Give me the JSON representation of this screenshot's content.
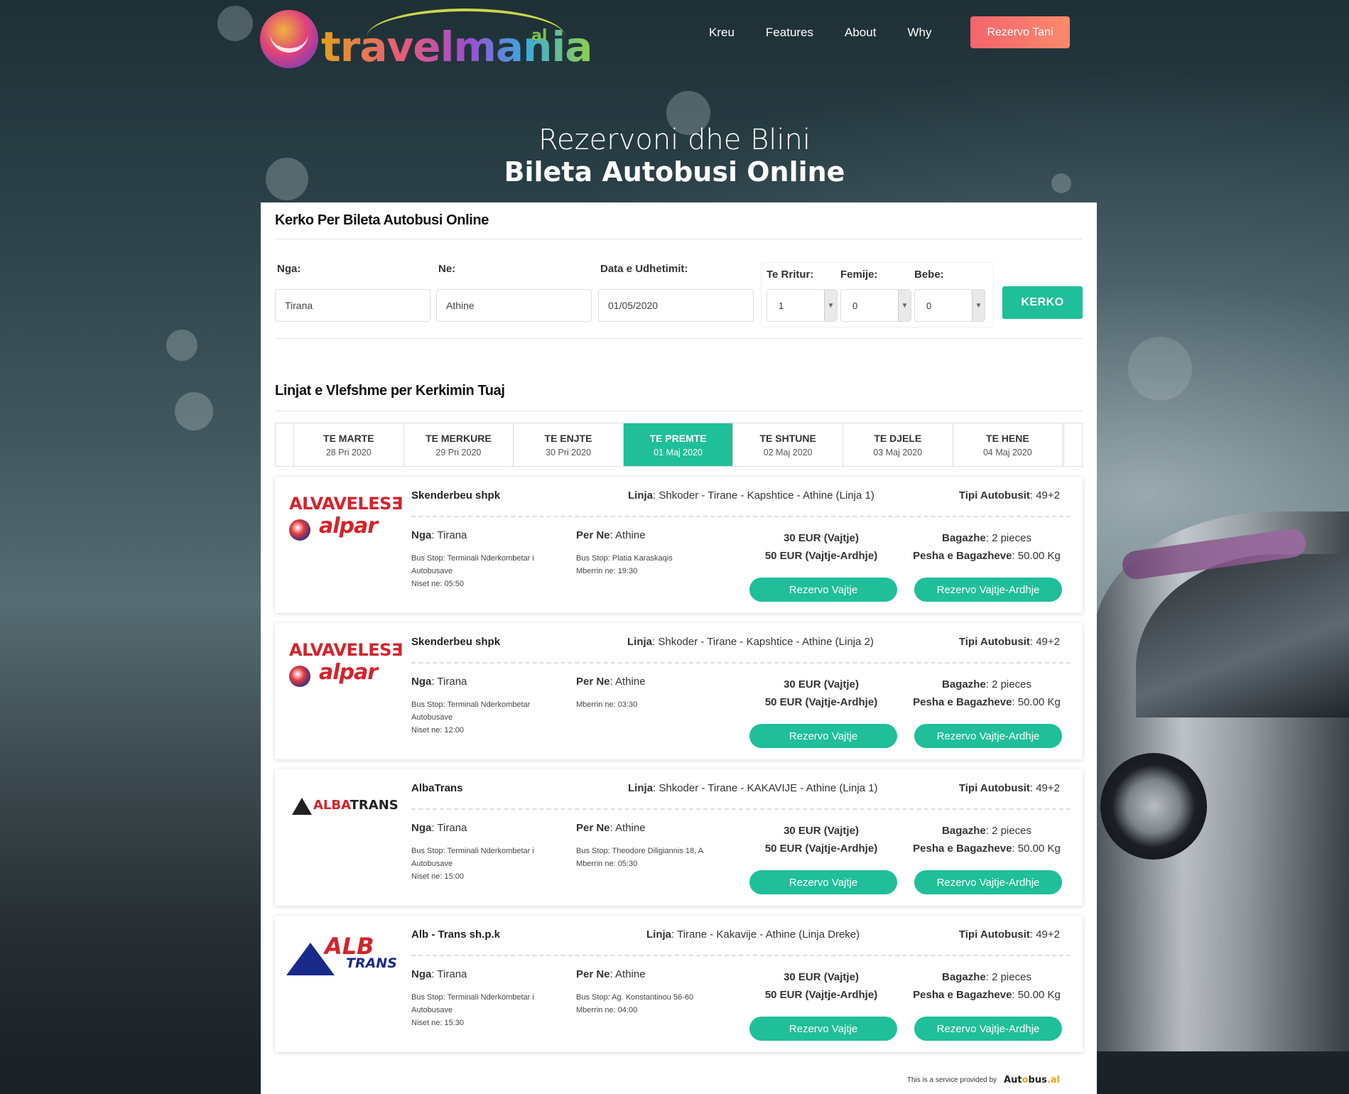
{
  "brand": {
    "name": "travelmania",
    "suffix": "al"
  },
  "nav": {
    "items": [
      "Kreu",
      "Features",
      "About",
      "Why"
    ],
    "cta": "Rezervo Tani"
  },
  "hero": {
    "line1": "Rezervoni dhe Blini",
    "line2": "Bileta Autobusi Online"
  },
  "search": {
    "title": "Kerko Per Bileta Autobusi Online",
    "from_label": "Nga:",
    "from_value": "Tirana",
    "to_label": "Ne:",
    "to_value": "Athine",
    "date_label": "Data e Udhetimit:",
    "date_value": "01/05/2020",
    "adults_label": "Te Rritur:",
    "adults_value": "1",
    "children_label": "Femije:",
    "children_value": "0",
    "infants_label": "Bebe:",
    "infants_value": "0",
    "submit": "KERKO"
  },
  "results": {
    "title": "Linjat e Vlefshme per Kerkimin Tuaj",
    "days": [
      {
        "name": "TE MARTE",
        "date": "28 Pri 2020"
      },
      {
        "name": "TE MERKURE",
        "date": "29 Pri 2020"
      },
      {
        "name": "TE ENJTE",
        "date": "30 Pri 2020"
      },
      {
        "name": "TE PREMTE",
        "date": "01 Maj 2020"
      },
      {
        "name": "TE SHTUNE",
        "date": "02 Maj 2020"
      },
      {
        "name": "TE DJELE",
        "date": "03 Maj 2020"
      },
      {
        "name": "TE HENE",
        "date": "04 Maj 2020"
      }
    ],
    "active_day": 3,
    "labels": {
      "route": "Linja",
      "bus_type": "Tipi Autobusit",
      "from": "Nga",
      "to": "Per Ne",
      "baggage": "Bagazhe",
      "baggage_weight": "Pesha e Bagazheve",
      "book_one_way": "Rezervo Vajtje",
      "book_return": "Rezervo Vajtje-Ardhje"
    },
    "cards": [
      {
        "logo_lines": [
          "ALVAVELESƎ",
          "alpar"
        ],
        "operator": "Skenderbeu shpk",
        "route": "Shkoder - Tirane - Kapshtice - Athine (Linja 1)",
        "bus_type": "49+2",
        "from": "Tirana",
        "to": "Athine",
        "from_stop": "Bus Stop: Terminali Nderkombetar i",
        "from_stop2": "Autobusave",
        "departure": "Niset ne: 05:50",
        "to_stop": "Bus Stop: Platia Karaskaqis",
        "arrival": "Mberrin ne: 19:30",
        "price_one": "30 EUR (Vajtje)",
        "price_return": "50 EUR (Vajtje-Ardhje)",
        "baggage": "2 pieces",
        "baggage_weight": "50.00 Kg"
      },
      {
        "logo_lines": [
          "ALVAVELESƎ",
          "alpar"
        ],
        "operator": "Skenderbeu shpk",
        "route": "Shkoder - Tirane - Kapshtice - Athine (Linja 2)",
        "bus_type": "49+2",
        "from": "Tirana",
        "to": "Athine",
        "from_stop": "Bus Stop: Terminali Nderkombetar",
        "from_stop2": "Autobusave",
        "departure": "Niset ne: 12:00",
        "to_stop": "",
        "arrival": "Mberrin ne: 03:30",
        "price_one": "30 EUR (Vajtje)",
        "price_return": "50 EUR (Vajtje-Ardhje)",
        "baggage": "2 pieces",
        "baggage_weight": "50.00 Kg"
      },
      {
        "logo_lines": [
          "ALBA",
          "TRANS"
        ],
        "operator": "AlbaTrans",
        "route": "Shkoder - Tirane - KAKAVIJE - Athine (Linja 1)",
        "bus_type": "49+2",
        "from": "Tirana",
        "to": "Athine",
        "from_stop": "Bus Stop: Terminali Nderkombetar i",
        "from_stop2": "Autobusave",
        "departure": "Niset ne: 15:00",
        "to_stop": "Bus Stop: Theodore Diligiannis 18, A",
        "arrival": "Mberrin ne: 05:30",
        "price_one": "30 EUR (Vajtje)",
        "price_return": "50 EUR (Vajtje-Ardhje)",
        "baggage": "2 pieces",
        "baggage_weight": "50.00 Kg"
      },
      {
        "logo_lines": [
          "ALB",
          "TRANS"
        ],
        "operator": "Alb - Trans sh.p.k",
        "route": "Tirane - Kakavije - Athine (Linja Dreke)",
        "bus_type": "49+2",
        "from": "Tirana",
        "to": "Athine",
        "from_stop": "Bus Stop: Terminali Nderkombetar i",
        "from_stop2": "Autobusave",
        "departure": "Niset ne: 15:30",
        "to_stop": "Bus Stop: Ag. Konstantinou 56-60",
        "arrival": "Mberrin ne: 04:00",
        "price_one": "30 EUR (Vajtje)",
        "price_return": "50 EUR (Vajtje-Ardhje)",
        "baggage": "2 pieces",
        "baggage_weight": "50.00 Kg"
      }
    ]
  },
  "footer": {
    "note": "This is a service provided by",
    "provider": [
      "Aut",
      "o",
      "bus",
      ".al"
    ]
  },
  "colors": {
    "accent": "#1fbf9a",
    "cta": "#f76e6d",
    "brand_red": "#d4232b",
    "brand_blue": "#1a2a8a"
  }
}
